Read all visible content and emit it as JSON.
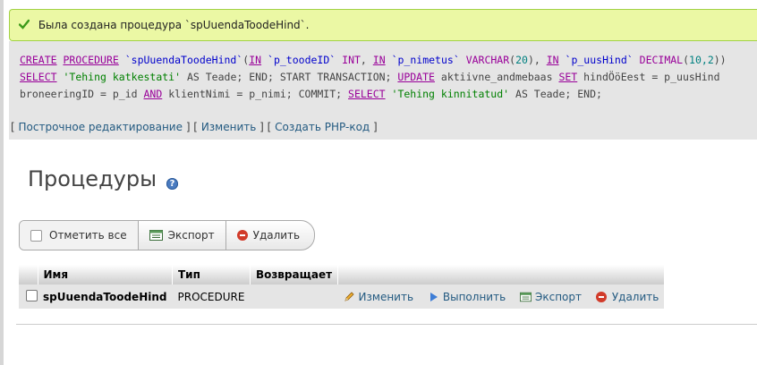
{
  "message": {
    "text": "Была создана процедура `spUuendaToodeHind`.",
    "color_bg": "#ebf8a4",
    "icon": "check-icon"
  },
  "sql": {
    "line1": {
      "create": "CREATE",
      "procedure": "PROCEDURE",
      "name": "`spUuendaToodeHind`",
      "p1_in": "IN",
      "p1": "`p_toodeID`",
      "p1_type": "INT",
      "p2_in": "IN",
      "p2": "`p_nimetus`",
      "p2_type": "VARCHAR",
      "p2_len": "20",
      "p3_in": "IN",
      "p3": "`p_uusHind`",
      "p3_type": "DECIMAL",
      "p3_len": "10,2"
    },
    "line2": {
      "select": "SELECT",
      "str": "'Tehing katkestati'",
      "as": "AS Teade; END; START TRANSACTION;",
      "update": "UPDATE",
      "table": "aktiivne_andmebaas",
      "set": "SET",
      "assign": "hindÖöEest = p_uusHind"
    },
    "line3": {
      "a": "broneeringID = p_id",
      "and": "AND",
      "b": "klientNimi = p_nimi; COMMIT;",
      "select": "SELECT",
      "str": "'Tehing kinnitatud'",
      "as": "AS Teade; END;"
    }
  },
  "links": {
    "inline_edit": "Построчное редактирование",
    "edit": "Изменить",
    "php": "Создать PHP-код"
  },
  "title": "Процедуры",
  "toolbar": {
    "check_all": "Отметить все",
    "export": "Экспорт",
    "delete": "Удалить"
  },
  "table": {
    "headers": [
      "Имя",
      "Тип",
      "Возвращает",
      ""
    ],
    "rows": [
      {
        "name": "spUuendaToodeHind",
        "type": "PROCEDURE",
        "returns": "",
        "actions": [
          "Изменить",
          "Выполнить",
          "Экспорт",
          "Удалить"
        ]
      }
    ]
  }
}
